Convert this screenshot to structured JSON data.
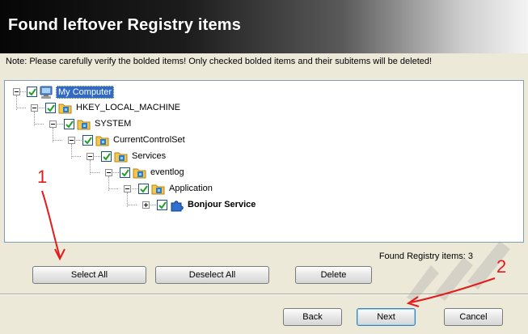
{
  "header": {
    "title": "Found leftover Registry items"
  },
  "note": "Note: Please carefully verify the bolded items! Only checked bolded items and their subitems will be deleted!",
  "tree": {
    "nodes": [
      {
        "label": "My Computer",
        "checked": true,
        "icon": "computer-icon",
        "selected": true
      },
      {
        "label": "HKEY_LOCAL_MACHINE",
        "checked": true,
        "icon": "registry-folder-icon"
      },
      {
        "label": "SYSTEM",
        "checked": true,
        "icon": "registry-folder-icon"
      },
      {
        "label": "CurrentControlSet",
        "checked": true,
        "icon": "registry-folder-icon"
      },
      {
        "label": "Services",
        "checked": true,
        "icon": "registry-folder-icon"
      },
      {
        "label": "eventlog",
        "checked": true,
        "icon": "registry-folder-icon"
      },
      {
        "label": "Application",
        "checked": true,
        "icon": "registry-folder-icon"
      },
      {
        "label": "Bonjour Service",
        "checked": true,
        "icon": "puzzle-icon",
        "bold": true
      }
    ]
  },
  "found": {
    "label": "Found Registry items:",
    "count": "3"
  },
  "buttons": {
    "select_all": "Select All",
    "deselect_all": "Deselect All",
    "delete": "Delete",
    "back": "Back",
    "next": "Next",
    "cancel": "Cancel"
  },
  "annotations": {
    "one": "1",
    "two": "2"
  },
  "colors": {
    "accent": "#316ac5",
    "annotation": "#e31b1b"
  }
}
